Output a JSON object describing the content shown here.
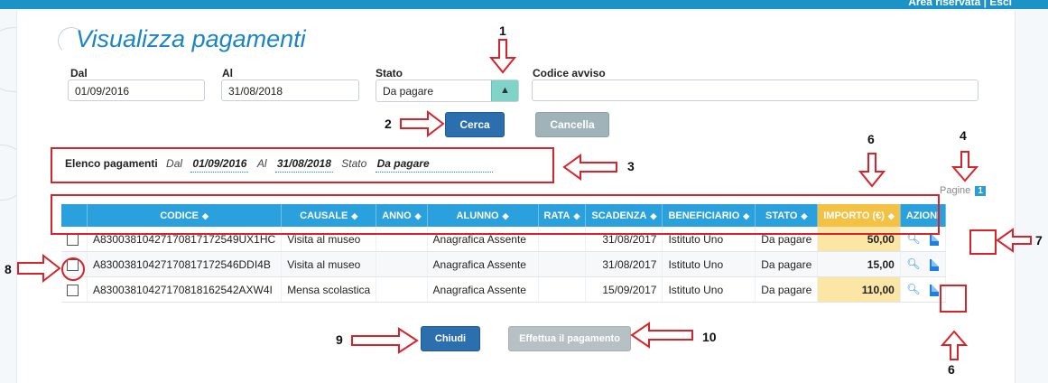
{
  "header": {
    "title": "Visualizza pagamenti",
    "top_hint": "Area riservata | Esci"
  },
  "filters": {
    "dal_label": "Dal",
    "dal_value": "01/09/2016",
    "al_label": "Al",
    "al_value": "31/08/2018",
    "stato_label": "Stato",
    "stato_value": "Da pagare",
    "codice_label": "Codice avviso",
    "codice_value": "",
    "cerca_label": "Cerca",
    "cancella_label": "Cancella"
  },
  "summary": {
    "title": "Elenco pagamenti",
    "dal_label": "Dal",
    "dal_value": "01/09/2016",
    "al_label": "Al",
    "al_value": "31/08/2018",
    "stato_label": "Stato",
    "stato_value": "Da pagare"
  },
  "pagination": {
    "label": "Pagine",
    "current": "1"
  },
  "table": {
    "columns": [
      "CODICE",
      "CAUSALE",
      "ANNO",
      "ALUNNO",
      "RATA",
      "SCADENZA",
      "BENEFICIARIO",
      "STATO",
      "IMPORTO (€)",
      "AZIONI"
    ],
    "rows": [
      {
        "codice": "A83003810427170817172549UX1HC",
        "causale": "Visita al museo",
        "anno": "",
        "alunno": "Anagrafica Assente",
        "rata": "",
        "scadenza": "31/08/2017",
        "beneficiario": "Istituto Uno",
        "stato": "Da pagare",
        "importo": "50,00"
      },
      {
        "codice": "A83003810427170817172546DDI4B",
        "causale": "Visita al museo",
        "anno": "",
        "alunno": "Anagrafica Assente",
        "rata": "",
        "scadenza": "31/08/2017",
        "beneficiario": "Istituto Uno",
        "stato": "Da pagare",
        "importo": "15,00"
      },
      {
        "codice": "A83003810427170818162542AXW4I",
        "causale": "Mensa scolastica",
        "anno": "",
        "alunno": "Anagrafica Assente",
        "rata": "",
        "scadenza": "15/09/2017",
        "beneficiario": "Istituto Uno",
        "stato": "Da pagare",
        "importo": "110,00"
      }
    ]
  },
  "footer": {
    "chiudi_label": "Chiudi",
    "paga_label": "Effettua il pagamento"
  },
  "annotations": {
    "n1": "1",
    "n2": "2",
    "n3": "3",
    "n4": "4",
    "n6a": "6",
    "n6b": "6",
    "n7": "7",
    "n8": "8",
    "n9": "9",
    "n10": "10"
  },
  "colors": {
    "accent": "#1a85c4",
    "header_blue": "#2aa1dd",
    "importo_header": "#f3c245",
    "annotation_red": "#d8232a"
  }
}
